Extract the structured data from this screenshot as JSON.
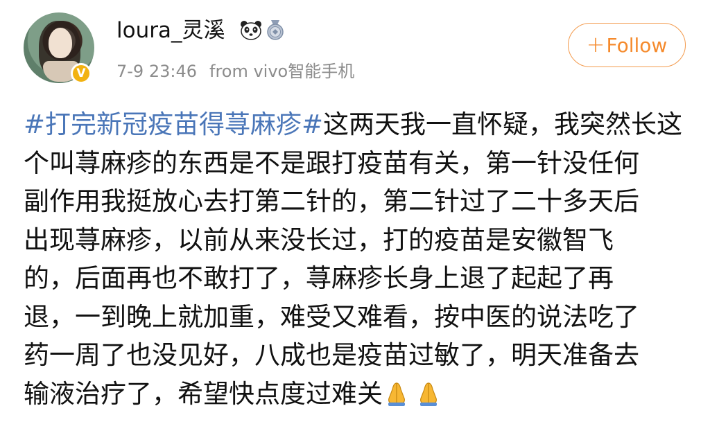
{
  "post": {
    "author": {
      "username": "loura_灵溪",
      "verified_badge": "V",
      "badge_icons": [
        "panda-icon",
        "medal-icon"
      ]
    },
    "date": "7-9 23:46",
    "source": "from vivo智能手机",
    "follow_button": {
      "icon": "+",
      "label": "Follow"
    },
    "hashtag": "#打完新冠疫苗得荨麻疹#",
    "lines": [
      "这两天我一直怀疑，我突然长这",
      "个叫荨麻疹的东西是不是跟打疫苗有关，第一针没任何",
      "副作用我挺放心去打第二针的，第二针过了二十多天后",
      "出现荨麻疹，以前从来没长过，打的疫苗是安徽智飞",
      "的，后面再也不敢打了，荨麻疹长身上退了起起了再",
      "退，一到晚上就加重，难受又难看，按中医的说法吃了",
      "药一周了也没见好，八成也是疫苗过敏了，明天准备去",
      "输液治疗了，希望快点度过难关"
    ],
    "trailing_emojis": [
      "folded-hands-icon",
      "folded-hands-icon"
    ],
    "colors": {
      "hashtag": "#4a76b8",
      "follow_accent": "#f58a2c",
      "meta_gray": "#8c8c8c",
      "verified_gold": "#f2b211"
    }
  }
}
